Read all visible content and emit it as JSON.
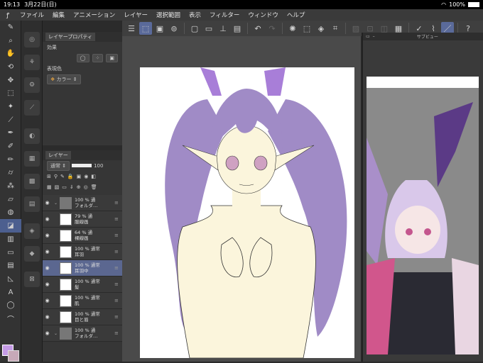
{
  "status": {
    "time": "19:13",
    "date": "3月22日(日)",
    "battery": "100%"
  },
  "menu": [
    "ファイル",
    "編集",
    "アニメーション",
    "レイヤー",
    "選択範囲",
    "表示",
    "フィルター",
    "ウィンドウ",
    "ヘルプ"
  ],
  "layer_property": {
    "tab_label": "レイヤープロパティ",
    "effect_label": "効果",
    "color_label": "表現色",
    "color_value": "カラー"
  },
  "layer_panel": {
    "tab_label": "レイヤー",
    "blend_mode": "通常",
    "opacity": "100",
    "layers": [
      {
        "line1": "100 % 通",
        "line2": "フォルダ…",
        "folder": true
      },
      {
        "line1": "79 % 通",
        "line2": "服線画"
      },
      {
        "line1": "64 % 通",
        "line2": "裸線画"
      },
      {
        "line1": "100 % 通常",
        "line2": "耳羽"
      },
      {
        "line1": "100 % 通常",
        "line2": "耳羽中",
        "selected": true
      },
      {
        "line1": "100 % 通常",
        "line2": "髪"
      },
      {
        "line1": "100 % 通常",
        "line2": "肌"
      },
      {
        "line1": "100 % 通常",
        "line2": "目と眉"
      },
      {
        "line1": "100 % 通",
        "line2": "フォルダ…",
        "folder": true
      }
    ]
  },
  "subview": {
    "title": "サブビュー"
  },
  "colors": {
    "main": "#c59be6",
    "sub": "#c7a9b8",
    "accent": "#4c5f8f"
  }
}
